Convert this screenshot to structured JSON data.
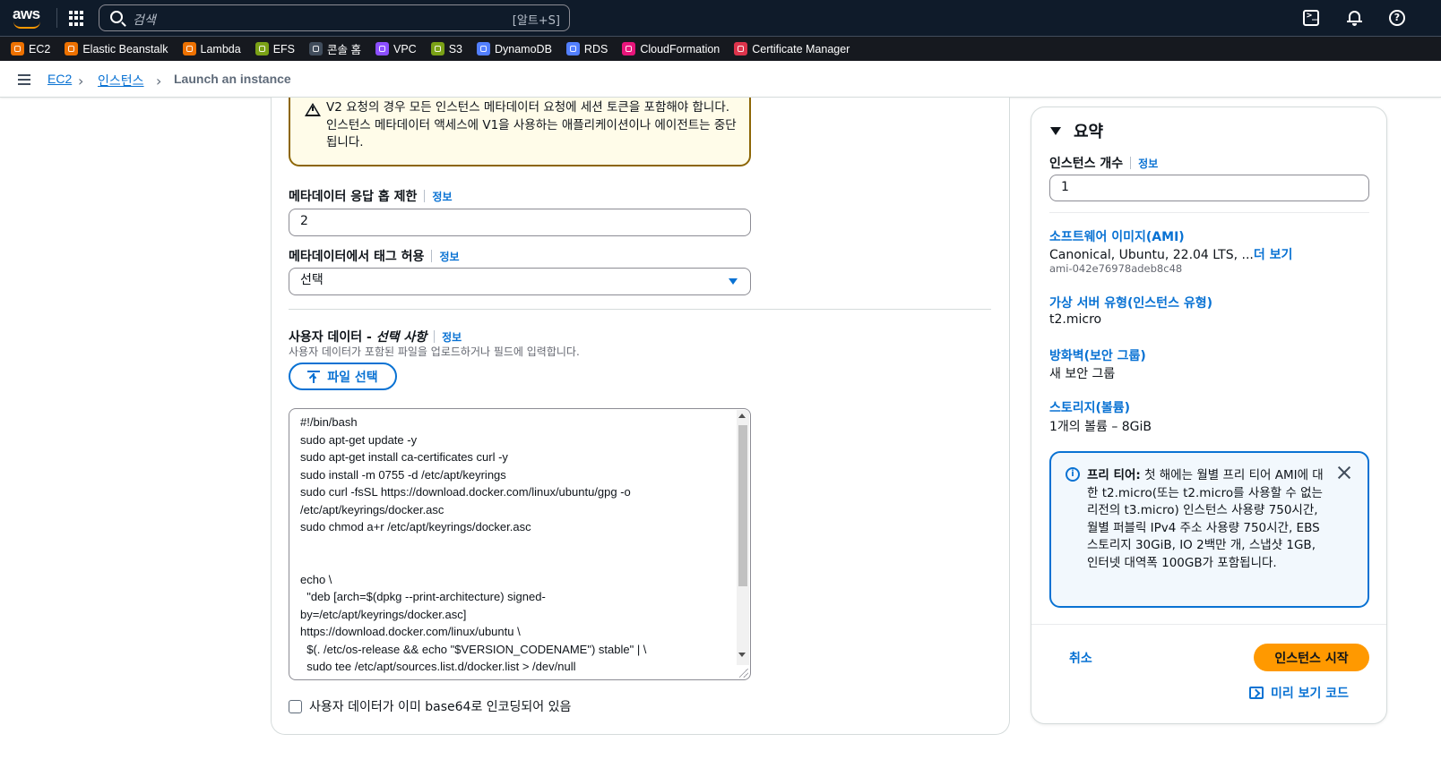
{
  "topnav": {
    "logo_text": "aws",
    "search_placeholder": "검색",
    "search_shortcut": "[알트+S]",
    "icons": [
      "services-grid-icon",
      "search-icon",
      "cloudshell-icon",
      "bell-icon",
      "help-icon"
    ]
  },
  "favorites": [
    {
      "label": "EC2",
      "color": "#ed7100",
      "icon": "ec2-icon"
    },
    {
      "label": "Elastic Beanstalk",
      "color": "#ed7100",
      "icon": "elastic-beanstalk-icon"
    },
    {
      "label": "Lambda",
      "color": "#ed7100",
      "icon": "lambda-icon"
    },
    {
      "label": "EFS",
      "color": "#7aa116",
      "icon": "efs-icon"
    },
    {
      "label": "콘솔 홈",
      "color": "#414d5c",
      "icon": "console-home-icon"
    },
    {
      "label": "VPC",
      "color": "#8c4fff",
      "icon": "vpc-icon"
    },
    {
      "label": "S3",
      "color": "#7aa116",
      "icon": "s3-icon"
    },
    {
      "label": "DynamoDB",
      "color": "#527fff",
      "icon": "dynamodb-icon"
    },
    {
      "label": "RDS",
      "color": "#527fff",
      "icon": "rds-icon"
    },
    {
      "label": "CloudFormation",
      "color": "#e7157b",
      "icon": "cloudformation-icon"
    },
    {
      "label": "Certificate Manager",
      "color": "#dd344c",
      "icon": "certificate-manager-icon"
    }
  ],
  "breadcrumb": {
    "items": [
      "EC2",
      "인스턴스"
    ],
    "current": "Launch an instance"
  },
  "metadata": {
    "warning_text": "V2 요청의 경우 모든 인스턴스 메타데이터 요청에 세션 토큰을 포함해야 합니다. 인스턴스 메타데이터 액세스에 V1을 사용하는 애플리케이션이나 에이전트는 중단됩니다.",
    "hop_limit_label": "메타데이터 응답 홉 제한",
    "hop_limit_value": "2",
    "tags_label": "메타데이터에서 태그 허용",
    "tags_value": "선택",
    "info": "정보"
  },
  "user_data": {
    "label_prefix": "사용자 데이터 - ",
    "label_optional": "선택 사항",
    "description": "사용자 데이터가 포함된 파일을 업로드하거나 필드에 입력합니다.",
    "file_button": "파일 선택",
    "lines": [
      "#!/bin/bash",
      "sudo apt-get update -y",
      "sudo apt-get install ca-certificates curl -y",
      "sudo install -m 0755 -d /etc/apt/keyrings",
      "sudo curl -fsSL https://download.docker.com/linux/ubuntu/gpg -o",
      "/etc/apt/keyrings/docker.asc",
      "sudo chmod a+r /etc/apt/keyrings/docker.asc",
      "",
      "",
      "echo \\",
      "  \"deb [arch=$(dpkg --print-architecture) signed-",
      "by=/etc/apt/keyrings/docker.asc]",
      "https://download.docker.com/linux/ubuntu \\",
      "  $(. /etc/os-release && echo \"$VERSION_CODENAME\") stable\" | \\",
      "  sudo tee /etc/apt/sources.list.d/docker.list > /dev/null"
    ],
    "base64_checkbox_label": "사용자 데이터가 이미 base64로 인코딩되어 있음"
  },
  "summary": {
    "title": "요약",
    "instance_count_label": "인스턴스 개수",
    "instance_count_value": "1",
    "info": "정보",
    "ami_label": "소프트웨어 이미지(AMI)",
    "ami_value": "Canonical, Ubuntu, 22.04 LTS, ...",
    "ami_more": "더 보기",
    "ami_id": "ami-042e76978adeb8c48",
    "instance_type_label": "가상 서버 유형(인스턴스 유형)",
    "instance_type_value": "t2.micro",
    "firewall_label": "방화벽(보안 그룹)",
    "firewall_value": "새 보안 그룹",
    "storage_label": "스토리지(볼륨)",
    "storage_value": "1개의 볼륨 – 8GiB",
    "free_tier_title": "프리 티어:",
    "free_tier_text": " 첫 해에는 월별 프리 티어 AMI에 대한 t2.micro(또는 t2.micro를 사용할 수 없는 리전의 t3.micro) 인스턴스 사용량 750시간, 월별 퍼블릭 IPv4 주소 사용량 750시간, EBS 스토리지 30GiB, IO 2백만 개, 스냅샷 1GB, 인터넷 대역폭 100GB가 포함됩니다.",
    "cancel": "취소",
    "launch": "인스턴스 시작",
    "preview_code": "미리 보기 코드"
  },
  "colors": {
    "nav_bg": "#0f1b2a",
    "fav_bg": "#16191f",
    "link": "#0972d3",
    "primary_button": "#ff9900",
    "warning_border": "#8d6605",
    "warning_bg": "#fffce9",
    "info_bg": "#f2f8fd"
  }
}
